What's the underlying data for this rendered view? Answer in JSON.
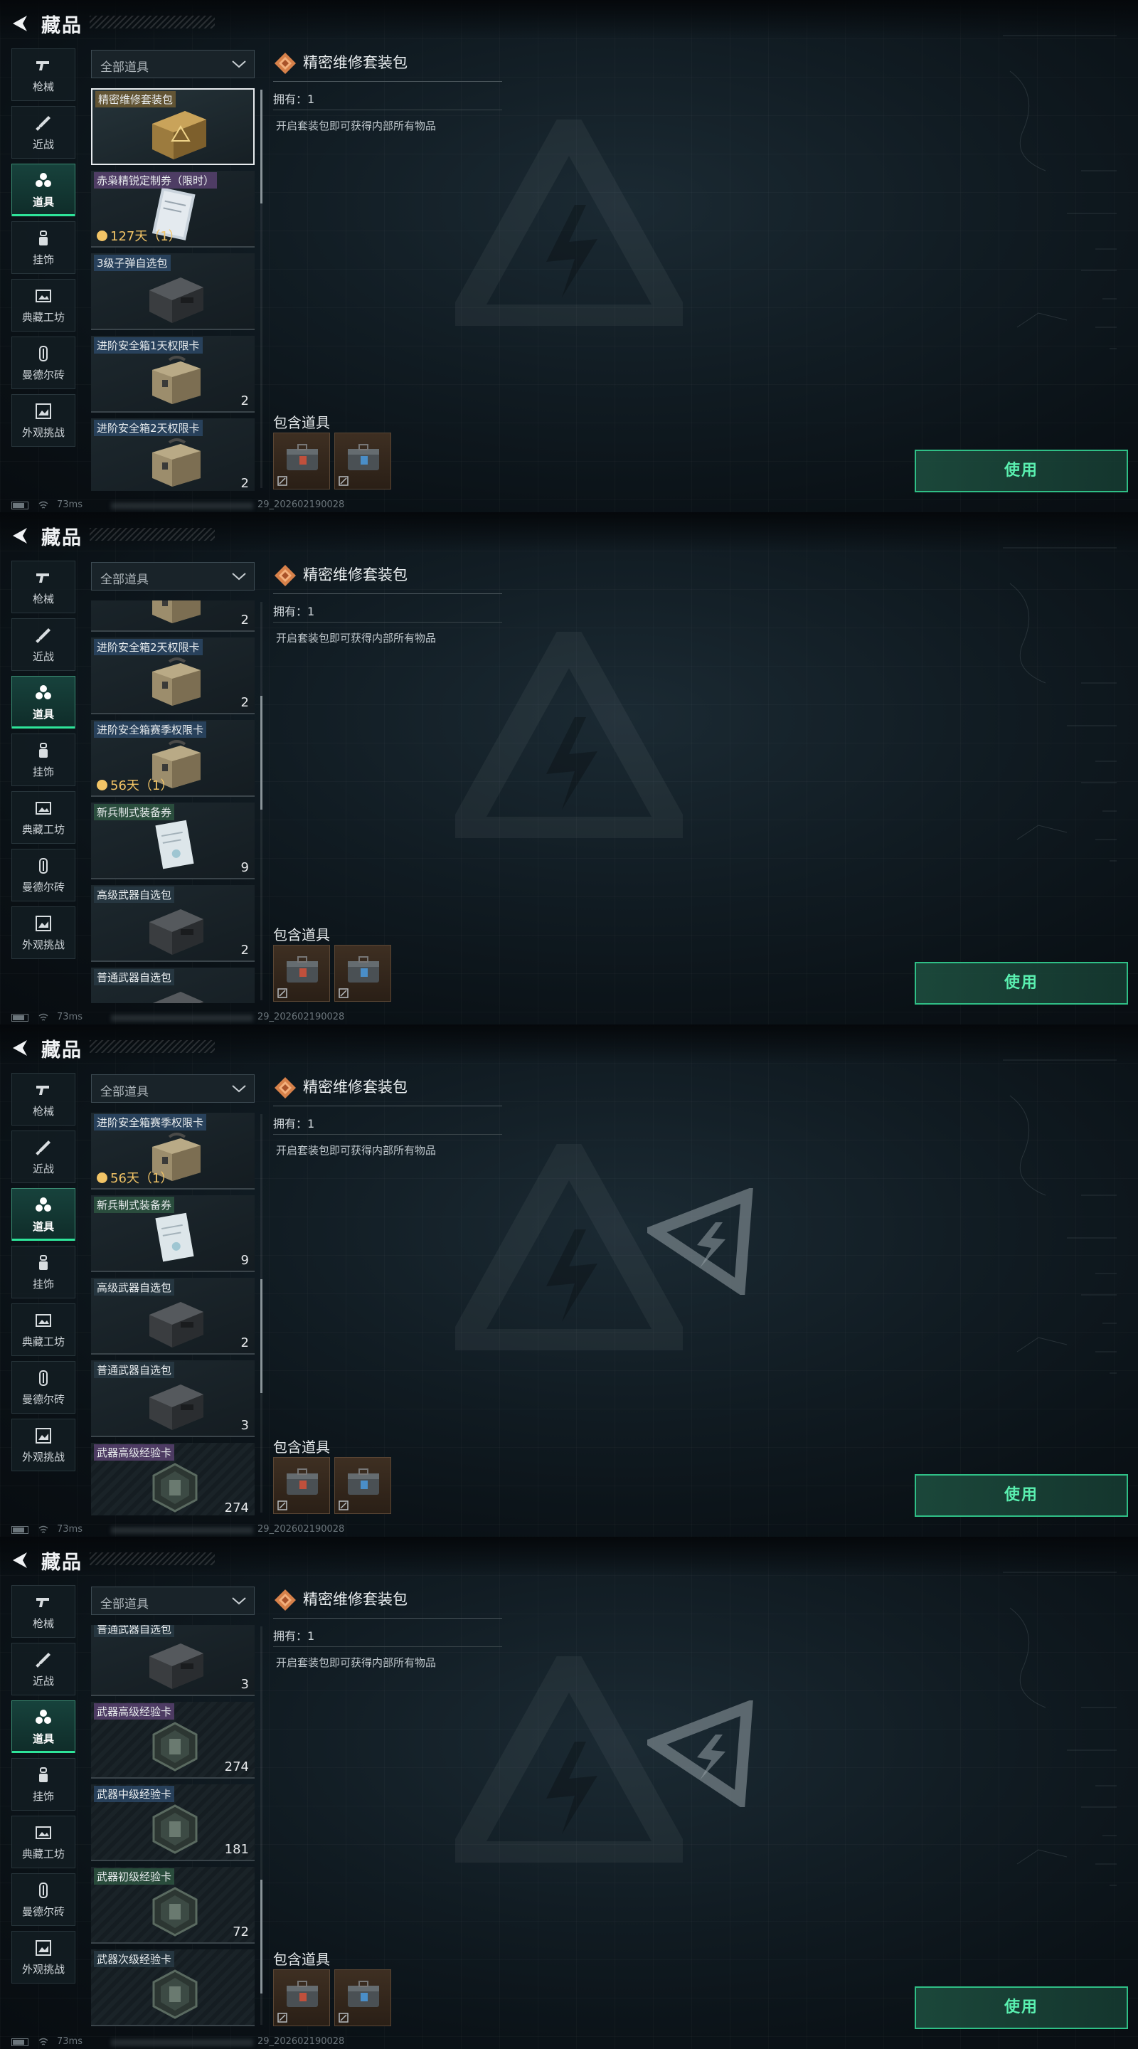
{
  "header": {
    "title": "藏品"
  },
  "categories": [
    {
      "label": "枪械",
      "icon": "gun-icon"
    },
    {
      "label": "近战",
      "icon": "knife-icon"
    },
    {
      "label": "道具",
      "icon": "items-icon"
    },
    {
      "label": "挂饰",
      "icon": "charm-icon"
    },
    {
      "label": "典藏工坊",
      "icon": "workshop-icon"
    },
    {
      "label": "曼德尔砖",
      "icon": "brick-icon"
    },
    {
      "label": "外观挑战",
      "icon": "challenge-icon"
    }
  ],
  "active_category_index": 2,
  "filter": {
    "value": "全部道具"
  },
  "detail": {
    "title": "精密维修套装包",
    "owned": "拥有：1",
    "description": "开启套装包即可获得内部所有物品",
    "contains_label": "包含道具",
    "use_label": "使用"
  },
  "status": {
    "ping": "73ms",
    "build": "29_202602190028"
  },
  "colors": {
    "accent": "#2ee59a",
    "use_border": "#2fbf86",
    "timer": "#f2c466"
  },
  "items": [
    {
      "name": "精密维修套装包",
      "rarity": "gold",
      "art": "case-gold",
      "count": "",
      "timer": ""
    },
    {
      "name": "赤枭精锐定制券（限时）",
      "rarity": "purple",
      "art": "ticket",
      "count": "",
      "timer": "127天（1）"
    },
    {
      "name": "3级子弹自选包",
      "rarity": "blue",
      "art": "case-dark",
      "count": "",
      "timer": ""
    },
    {
      "name": "进阶安全箱1天权限卡",
      "rarity": "blue",
      "art": "case-tan",
      "count": "2",
      "timer": ""
    },
    {
      "name": "进阶安全箱2天权限卡",
      "rarity": "blue",
      "art": "case-tan",
      "count": "2",
      "timer": ""
    },
    {
      "name": "进阶安全箱赛季权限卡",
      "rarity": "blue",
      "art": "case-tan",
      "count": "",
      "timer": "56天（1）"
    },
    {
      "name": "新兵制式装备券",
      "rarity": "green",
      "art": "paper",
      "count": "9",
      "timer": ""
    },
    {
      "name": "高级武器自选包",
      "rarity": "plain",
      "art": "case-dark",
      "count": "2",
      "timer": ""
    },
    {
      "name": "普通武器自选包",
      "rarity": "plain",
      "art": "case-dark",
      "count": "3",
      "timer": ""
    },
    {
      "name": "武器高级经验卡",
      "rarity": "purple",
      "art": "hex",
      "count": "274",
      "timer": ""
    },
    {
      "name": "武器中级经验卡",
      "rarity": "blue",
      "art": "hex",
      "count": "181",
      "timer": ""
    },
    {
      "name": "武器初级经验卡",
      "rarity": "green",
      "art": "hex",
      "count": "72",
      "timer": ""
    },
    {
      "name": "武器次级经验卡",
      "rarity": "plain",
      "art": "hex",
      "count": "",
      "timer": ""
    }
  ],
  "contained_items": [
    {
      "icon": "repair-kit-red-icon"
    },
    {
      "icon": "repair-kit-blue-icon"
    }
  ],
  "frames": [
    {
      "scroll_item_offset": 0.0,
      "scroll_position": 0.0,
      "extra_logo": false
    },
    {
      "scroll_item_offset": 3.55,
      "scroll_position": 0.33,
      "extra_logo": false
    },
    {
      "scroll_item_offset": 5.0,
      "scroll_position": 0.58,
      "extra_logo": true
    },
    {
      "scroll_item_offset": 8.07,
      "scroll_position": 0.89,
      "extra_logo": true
    }
  ]
}
